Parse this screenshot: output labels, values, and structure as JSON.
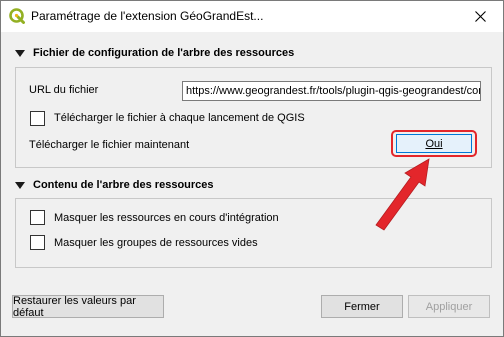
{
  "window": {
    "title": "Paramétrage de l'extension GéoGrandEst..."
  },
  "section1": {
    "header": "Fichier de configuration de l'arbre des ressources",
    "url_label": "URL du fichier",
    "url_value": "https://www.geograndest.fr/tools/plugin-qgis-geograndest/conf",
    "download_each_launch_label": "Télécharger le fichier à chaque lancement de QGIS",
    "download_each_launch_checked": false,
    "download_now_label": "Télécharger le fichier maintenant",
    "download_now_button": "Oui"
  },
  "section2": {
    "header": "Contenu de l'arbre des ressources",
    "hide_in_progress_label": "Masquer les ressources en cours d'intégration",
    "hide_in_progress_checked": false,
    "hide_empty_groups_label": "Masquer les groupes de ressources vides",
    "hide_empty_groups_checked": false
  },
  "footer": {
    "restore_defaults": "Restaurer les valeurs par défaut",
    "close": "Fermer",
    "apply": "Appliquer"
  },
  "colors": {
    "highlight": "#e3262b",
    "arrow": "#e3262b",
    "qgis_green": "#93b023"
  }
}
